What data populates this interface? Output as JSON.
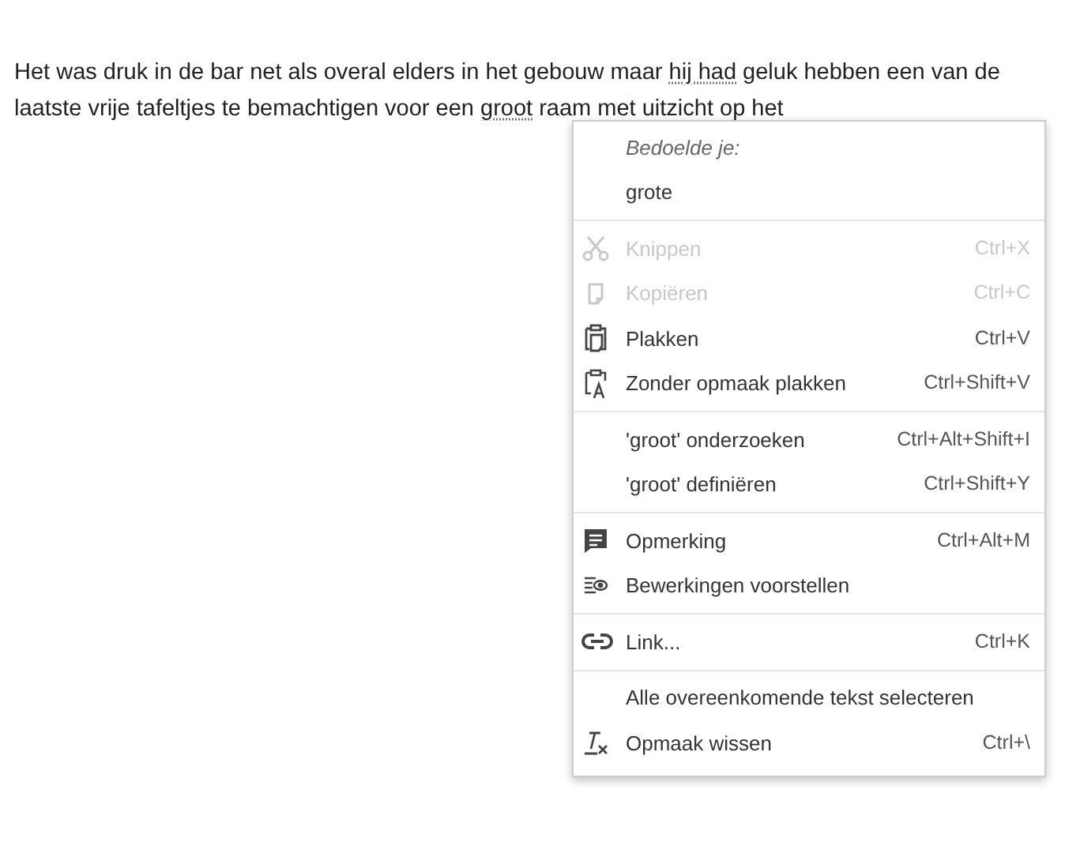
{
  "document": {
    "paragraph": [
      {
        "text": "Het was druk in de bar net als overal elders in het gebouw maar ",
        "flagged": false
      },
      {
        "text": "hij had",
        "flagged": true
      },
      {
        "text": " geluk hebben een van de laatste vrije tafeltjes te bemachtigen voor een ",
        "flagged": false
      },
      {
        "text": "groot",
        "flagged": true
      },
      {
        "text": " raam met uitzicht op het",
        "flagged": false
      }
    ]
  },
  "context_menu": {
    "groups": [
      {
        "items": [
          {
            "kind": "header",
            "label": "Bedoelde je:"
          },
          {
            "kind": "suggestion",
            "label": "grote"
          }
        ]
      },
      {
        "items": [
          {
            "kind": "command",
            "label": "Knippen",
            "shortcut": "Ctrl+X",
            "disabled": true
          },
          {
            "kind": "command",
            "label": "Kopiëren",
            "shortcut": "Ctrl+C",
            "disabled": true
          },
          {
            "kind": "command",
            "label": "Plakken",
            "shortcut": "Ctrl+V",
            "disabled": false
          },
          {
            "kind": "command",
            "label": "Zonder opmaak plakken",
            "shortcut": "Ctrl+Shift+V",
            "disabled": false
          }
        ]
      },
      {
        "items": [
          {
            "kind": "command",
            "label": "'groot' onderzoeken",
            "shortcut": "Ctrl+Alt+Shift+I",
            "disabled": false
          },
          {
            "kind": "command",
            "label": "'groot' definiëren",
            "shortcut": "Ctrl+Shift+Y",
            "disabled": false
          }
        ]
      },
      {
        "items": [
          {
            "kind": "command",
            "label": "Opmerking",
            "shortcut": "Ctrl+Alt+M",
            "disabled": false
          },
          {
            "kind": "command",
            "label": "Bewerkingen voorstellen",
            "disabled": false
          }
        ]
      },
      {
        "items": [
          {
            "kind": "command",
            "label": "Link...",
            "shortcut": "Ctrl+K",
            "disabled": false
          }
        ]
      },
      {
        "items": [
          {
            "kind": "command",
            "label": "Alle overeenkomende tekst selecteren",
            "disabled": false
          },
          {
            "kind": "command",
            "label": "Opmaak wissen",
            "shortcut": "Ctrl+\\",
            "disabled": false
          }
        ]
      }
    ]
  }
}
